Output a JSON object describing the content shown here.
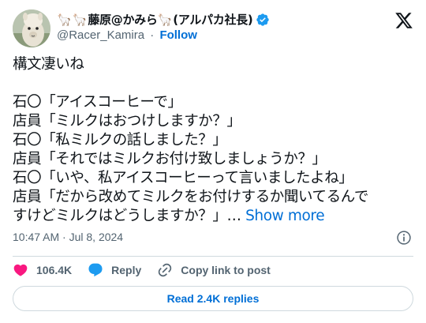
{
  "author": {
    "display_name": "藤原@かみら",
    "display_name_suffix": "(アルパカ社長)",
    "alpaca_emoji": "🦙",
    "handle": "@Racer_Kamira",
    "separator": "·",
    "follow_label": "Follow",
    "verified_color": "#1d9bf0"
  },
  "tweet": {
    "lines": [
      "構文凄いね",
      "",
      "石〇「アイスコーヒーで」",
      "店員「ミルクはおつけしますか？」",
      "石〇「私ミルクの話しました？」",
      "店員「それではミルクお付け致しましょうか？」",
      "石〇「いや、私アイスコーヒーって言いましたよね」",
      "店員「だから改めてミルクをお付けするか聞いてるんで",
      "すけどミルクはどうしますか？」… "
    ],
    "show_more_label": "Show more",
    "timestamp": "10:47 AM · Jul 8, 2024"
  },
  "actions": {
    "like_count": "106.4K",
    "reply_label": "Reply",
    "copy_link_label": "Copy link to post",
    "like_color": "#f91880",
    "reply_color": "#1d9bf0"
  },
  "footer": {
    "read_replies_label": "Read 2.4K replies"
  },
  "icons": [
    "alpaca-avatar",
    "verified-badge-icon",
    "x-logo-icon",
    "info-icon",
    "heart-icon",
    "reply-bubble-icon",
    "link-icon"
  ]
}
